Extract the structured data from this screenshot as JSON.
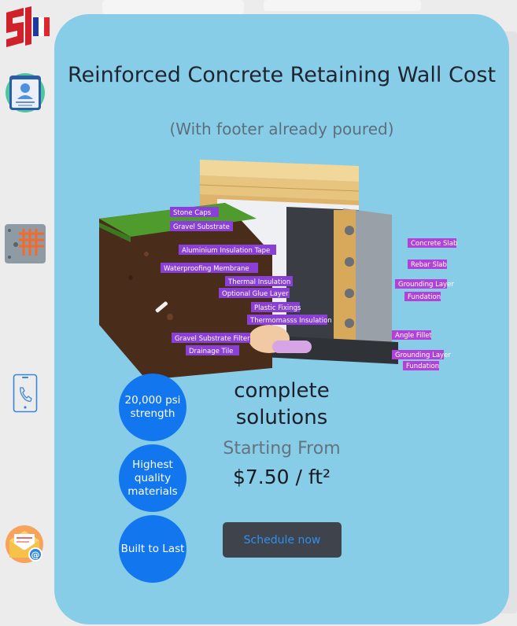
{
  "card": {
    "title": "Reinforced Concrete Retaining Wall Cost",
    "subtitle": "(With footer already poured)",
    "solutions": "complete solutions",
    "starting_label": "Starting From",
    "price": "$7.50 / ft²",
    "schedule_label": "Schedule now"
  },
  "badges": [
    {
      "text": "20,000 psi strength"
    },
    {
      "text": "Highest quality materials"
    },
    {
      "text": "Built to Last"
    }
  ],
  "callouts_left": [
    "Stone Caps",
    "Gravel Substrate",
    "Aluminium Insulation Tape",
    "Waterproofing Membrane",
    "Thermal Insulation",
    "Optional Glue Layer",
    "Plastic Fixings",
    "Thermomasss Insulation",
    "Gravel Substrate Filter",
    "Drainage Tile"
  ],
  "callouts_right": [
    "Concrete Slab",
    "Rebar Slab",
    "Grounding Layer",
    "Fundation",
    "Angle Fillet",
    "Grounding Layer",
    "Fundation"
  ],
  "sidebar": {
    "icons": [
      "logo-icon",
      "profile-card-icon",
      "grid-panel-icon",
      "phone-icon",
      "mail-icon"
    ]
  },
  "colors": {
    "card_bg": "#87cde8",
    "badge_bg": "#1277ee",
    "button_bg": "#3f444c",
    "button_text": "#2f8ff0",
    "callout_bg": "#8a3fd6"
  }
}
